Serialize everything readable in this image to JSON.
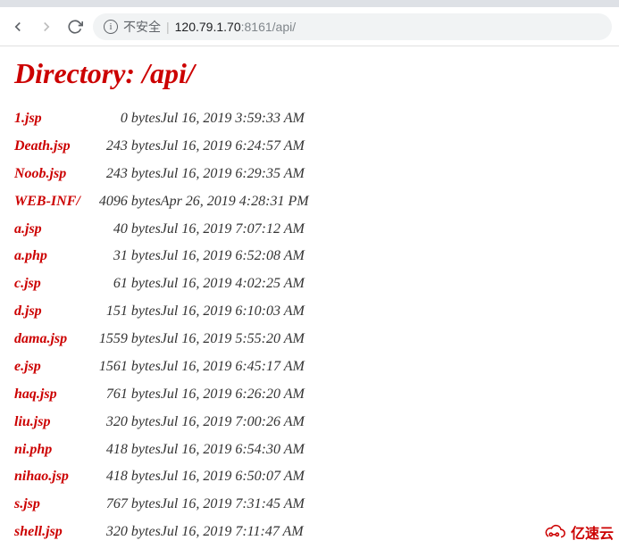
{
  "browser": {
    "security_label": "不安全",
    "url_host": "120.79.1.70",
    "url_port_path": ":8161/api/"
  },
  "page": {
    "title": "Directory: /api/"
  },
  "files": [
    {
      "name": "1.jsp",
      "size": "0 bytes",
      "date": "Jul 16, 2019 3:59:33 AM"
    },
    {
      "name": "Death.jsp",
      "size": "243 bytes",
      "date": "Jul 16, 2019 6:24:57 AM"
    },
    {
      "name": "Noob.jsp",
      "size": "243 bytes",
      "date": "Jul 16, 2019 6:29:35 AM"
    },
    {
      "name": "WEB-INF/",
      "size": "4096 bytes",
      "date": "Apr 26, 2019 4:28:31 PM"
    },
    {
      "name": "a.jsp",
      "size": "40 bytes",
      "date": "Jul 16, 2019 7:07:12 AM"
    },
    {
      "name": "a.php",
      "size": "31 bytes",
      "date": "Jul 16, 2019 6:52:08 AM"
    },
    {
      "name": "c.jsp",
      "size": "61 bytes",
      "date": "Jul 16, 2019 4:02:25 AM"
    },
    {
      "name": "d.jsp",
      "size": "151 bytes",
      "date": "Jul 16, 2019 6:10:03 AM"
    },
    {
      "name": "dama.jsp",
      "size": "1559 bytes",
      "date": "Jul 16, 2019 5:55:20 AM"
    },
    {
      "name": "e.jsp",
      "size": "1561 bytes",
      "date": "Jul 16, 2019 6:45:17 AM"
    },
    {
      "name": "haq.jsp",
      "size": "761 bytes",
      "date": "Jul 16, 2019 6:26:20 AM"
    },
    {
      "name": "liu.jsp",
      "size": "320 bytes",
      "date": "Jul 16, 2019 7:00:26 AM"
    },
    {
      "name": "ni.php",
      "size": "418 bytes",
      "date": "Jul 16, 2019 6:54:30 AM"
    },
    {
      "name": "nihao.jsp",
      "size": "418 bytes",
      "date": "Jul 16, 2019 6:50:07 AM"
    },
    {
      "name": "s.jsp",
      "size": "767 bytes",
      "date": "Jul 16, 2019 7:31:45 AM"
    },
    {
      "name": "shell.jsp",
      "size": "320 bytes",
      "date": "Jul 16, 2019 7:11:47 AM"
    }
  ],
  "watermark": {
    "text": "亿速云"
  }
}
